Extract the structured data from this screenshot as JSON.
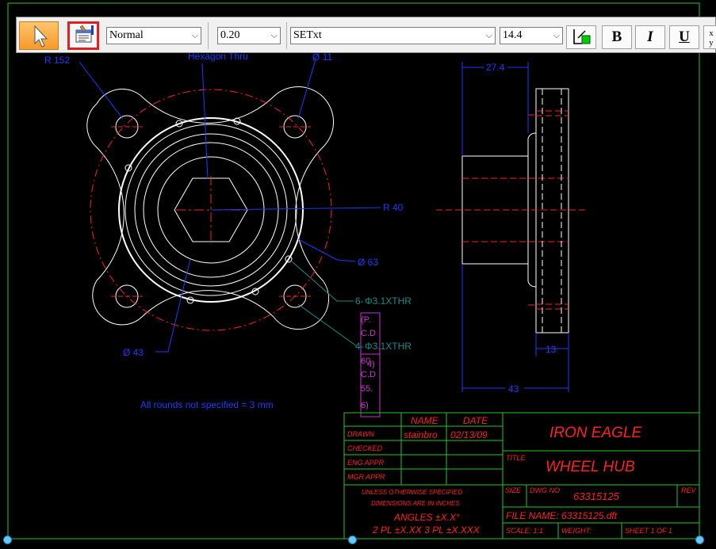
{
  "toolbar": {
    "style_value": "Normal",
    "line_width_value": "0.20",
    "font_value": "SETxt",
    "font_size_value": "14.4",
    "bold_label": "B",
    "italic_label": "I",
    "underline_label": "U",
    "stack_top": "x",
    "stack_bottom": "y"
  },
  "drawing": {
    "dims": {
      "r152": "R 152",
      "hexagon_thru": "Hexagon Thru",
      "dia11": "Ø 11",
      "r40": "R 40",
      "dia63": "Ø 63",
      "dia43": "Ø 43",
      "six_holes": "6-",
      "phi1": "Φ3.1XTHR",
      "phi2": "Φ3.1XTHR",
      "four": "4-",
      "dim274": "27.4",
      "dim13": "13",
      "dim43": "43"
    },
    "stacked_label": [
      "(P.",
      "C.D",
      "60.",
      "4)",
      "C.D",
      "55.",
      "6)"
    ],
    "note": "All rounds not specified = 3 mm"
  },
  "title_block": {
    "name_hdr": "NAME",
    "date_hdr": "DATE",
    "drawn_label": "DRAWN",
    "drawn_name": "stainbro",
    "drawn_date": "02/13/09",
    "checked_label": "CHECKED",
    "eng_label": "ENG APPR",
    "mgr_label": "MGR APPR",
    "unless_line1": "UNLESS OTHERWISE SPECIFIED",
    "unless_line2": "DIMENSIONS ARE IN INCHES",
    "angles": "ANGLES ±X.X°",
    "tolerances": "2 PL ±X.XX 3 PL ±X.XXX",
    "company": "IRON EAGLE",
    "title_label": "TITLE",
    "title": "WHEEL HUB",
    "size_label": "SIZE",
    "dwg_label": "DWG NO",
    "dwg_no": "63315125",
    "rev_label": "REV",
    "file_name": "FILE NAME: 63315125.dft",
    "scale": "SCALE: 1:1",
    "weight": "WEIGHT:",
    "sheet": "SHEET 1 OF 1"
  },
  "colors": {
    "background": "#000000",
    "geometry": "#ffffff",
    "centerline": "#ff2020",
    "dimension": "#1a3cff",
    "hole_callout": "#1a8a8a",
    "border": "#22c822",
    "title_text": "#ff2020",
    "annotation_box": "#cc33cc",
    "toolbar_bg": "#f0f0f0",
    "highlight": "#e0201e"
  }
}
